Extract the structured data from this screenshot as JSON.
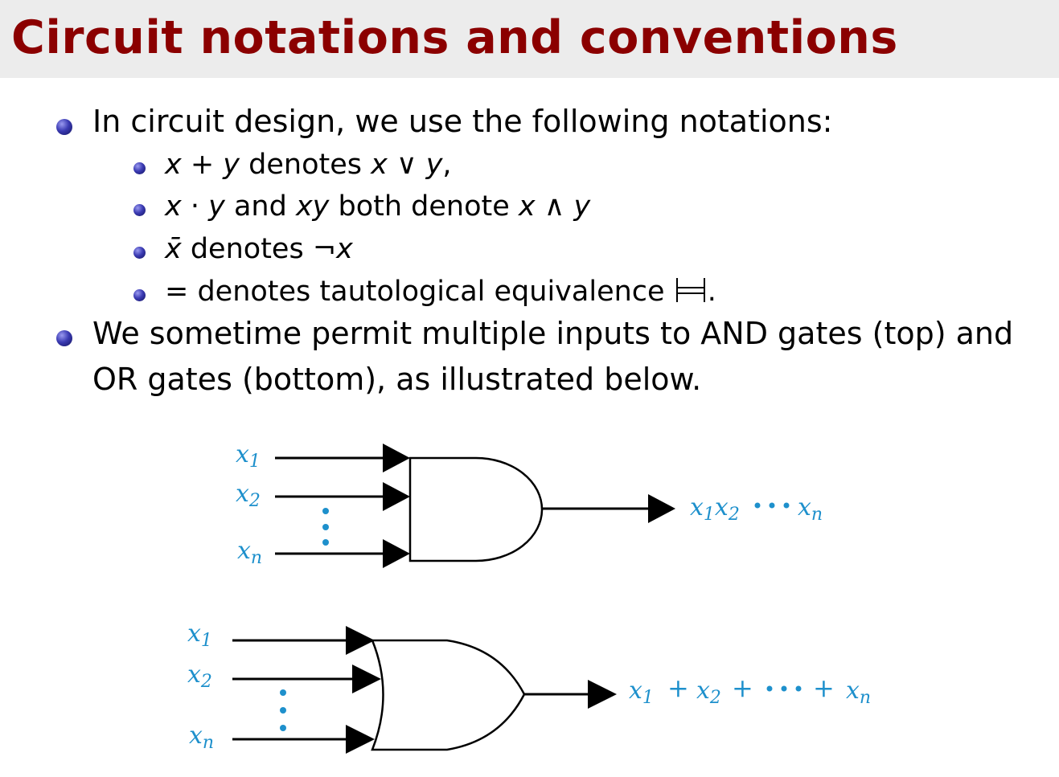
{
  "slide": {
    "title": "Circuit notations and conventions",
    "bullets": [
      {
        "text": "In circuit design, we use the following notations:"
      },
      {
        "text_line1": "We sometime permit multiple inputs to AND gates (top) and",
        "text_line2": "OR gates (bottom), as illustrated below."
      }
    ],
    "sub_bullets": [
      {
        "a": "x",
        "op": " + ",
        "b": "y",
        "mid": " denotes ",
        "c": "x",
        "op2": " ∨ ",
        "d": "y",
        "end": ","
      },
      {
        "a": "x",
        "op": " · ",
        "b": "y",
        "mid": " and ",
        "c": "xy",
        "mid2": " both denote ",
        "d": "x",
        "op2": " ∧ ",
        "e": "y"
      },
      {
        "a": "x̄",
        "mid": " denotes ",
        "neg": "¬",
        "b": "x"
      },
      {
        "a": "=",
        "mid": " denotes tautological equivalence ",
        "end": "."
      }
    ]
  },
  "diagram": {
    "and_gate": {
      "inputs": [
        "x1",
        "x2",
        "xn"
      ],
      "output": "x1x2•••xn"
    },
    "or_gate": {
      "inputs": [
        "x1",
        "x2",
        "xn"
      ],
      "output": "x1 + x2 + ••• + xn"
    },
    "label_color": "#1e90cc",
    "dots_color": "#1e90cc"
  }
}
